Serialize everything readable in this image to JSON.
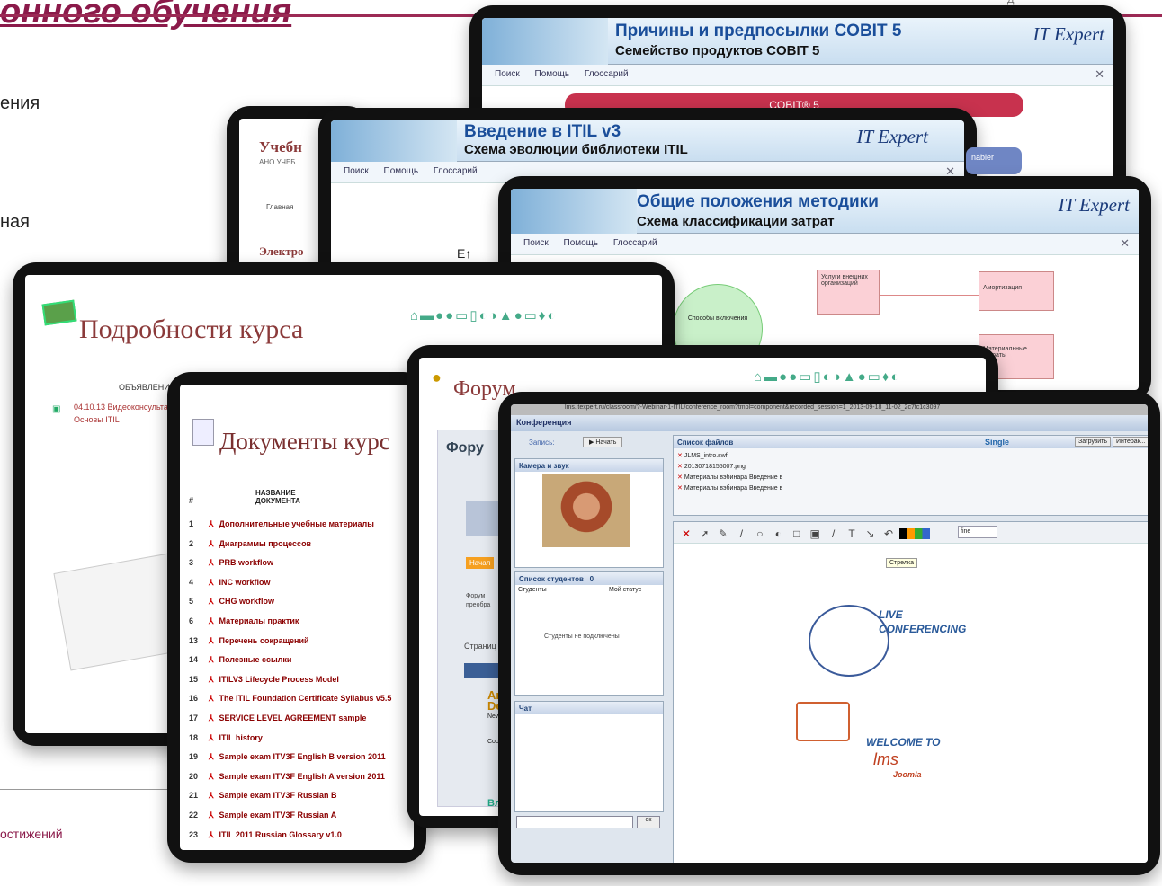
{
  "slide": {
    "title": "онного обучения",
    "left_text_1": "ения",
    "left_text_2": "ная",
    "footer_text": "остижений",
    "corner_text": "Д"
  },
  "cobit": {
    "title": "Причины и предпосылки COBIT 5",
    "subtitle": "Семейство продуктов COBIT 5",
    "logo": "IT Expert",
    "toolbar": [
      "Поиск",
      "Помощь",
      "Глоссарий"
    ],
    "pill": "COBIT® 5",
    "side_tag": "nabler"
  },
  "itil": {
    "title": "Введение в ITIL v3",
    "subtitle": "Схема эволюции библиотеки ITIL",
    "logo": "IT Expert",
    "toolbar": [
      "Поиск",
      "Помощь",
      "Глоссарий"
    ],
    "axis": "E"
  },
  "school": {
    "title": "Учебн",
    "sub": "АНО УЧЕБ",
    "nav": "Главная",
    "link": "Электро"
  },
  "costs": {
    "title": "Общие положения методики",
    "subtitle": "Схема классификации затрат",
    "logo": "IT Expert",
    "toolbar": [
      "Поиск",
      "Помощь",
      "Глоссарий"
    ],
    "box1": "Услуги внешних организаций",
    "box2": "Амортизация",
    "box3": "Материальные затраты",
    "circle": "Способы включения"
  },
  "course": {
    "title": "Подробности курса",
    "icons": "⌂▬●●▭▯◐◑▲●▭♦◐",
    "announce_header": "ОБЪЯВЛЕНИЯ",
    "announce_date": "04.10.13 Видеоконсультац",
    "announce_text": "Основы ITIL"
  },
  "docs": {
    "title": "Документы курс",
    "col_num": "#",
    "col_name": "НАЗВАНИЕ ДОКУМЕНТА",
    "rows": [
      {
        "n": "1",
        "name": "Дополнительные учебные материалы"
      },
      {
        "n": "2",
        "name": "Диаграммы процессов"
      },
      {
        "n": "3",
        "name": "PRB workflow"
      },
      {
        "n": "4",
        "name": "INC workflow"
      },
      {
        "n": "5",
        "name": "CHG workflow"
      },
      {
        "n": "6",
        "name": "Материалы практик"
      },
      {
        "n": "13",
        "name": "Перечень сокращений"
      },
      {
        "n": "14",
        "name": "Полезные ссылки"
      },
      {
        "n": "15",
        "name": "ITILV3 Lifecycle Process Model"
      },
      {
        "n": "16",
        "name": "The ITIL Foundation Certificate Syllabus v5.5"
      },
      {
        "n": "17",
        "name": "SERVICE LEVEL AGREEMENT sample"
      },
      {
        "n": "18",
        "name": "ITIL history"
      },
      {
        "n": "19",
        "name": "Sample exam ITV3F English B version 2011"
      },
      {
        "n": "20",
        "name": "Sample exam ITV3F English A version 2011"
      },
      {
        "n": "21",
        "name": "Sample exam ITV3F Russian B"
      },
      {
        "n": "22",
        "name": "Sample exam ITV3F Russian A"
      },
      {
        "n": "23",
        "name": "ITIL 2011 Russian Glossary v1.0"
      }
    ]
  },
  "forum": {
    "title": "Форум",
    "box_title": "Фору",
    "badge": "Начал",
    "text1": "Форум",
    "text2": "преобра",
    "text3": "Страниц",
    "name1": "Ar",
    "name2": "Dem",
    "newbie": "Newbi",
    "msg": "Сообщ",
    "tail": "Вл"
  },
  "conf": {
    "url": "lms.itexpert.ru/classroom/?-Webinar-1-ITIL/conference_room?tmpl=component&recorded_session=1_2013-09-18_11-02_2c7fc1c3097",
    "header": "Конференция",
    "record_label": "Запись:",
    "start_btn": "Начать",
    "camera_panel": "Камера и звук",
    "students_panel": "Список студентов",
    "students_count": "0",
    "col_students": "Студенты",
    "col_status": "Мой статус",
    "no_students": "Студенты не подключены",
    "chat_panel": "Чат",
    "ok_btn": "ок",
    "files_header": "Список файлов",
    "mode": "Single",
    "upload_btn": "Загрузить",
    "interactive_btn": "Интерак...",
    "files": [
      "JLMS_intro.swf",
      "20130718155007.png",
      "Материалы вэбинара Введение в",
      "Материалы вэбинара Введение в"
    ],
    "line_select": "fine",
    "tooltip": "Стрелка",
    "live1": "LIVE",
    "live2": "CONFERENCING",
    "welcome": "WELCOME TO",
    "lms": "lms",
    "joomla": "Joomla"
  }
}
